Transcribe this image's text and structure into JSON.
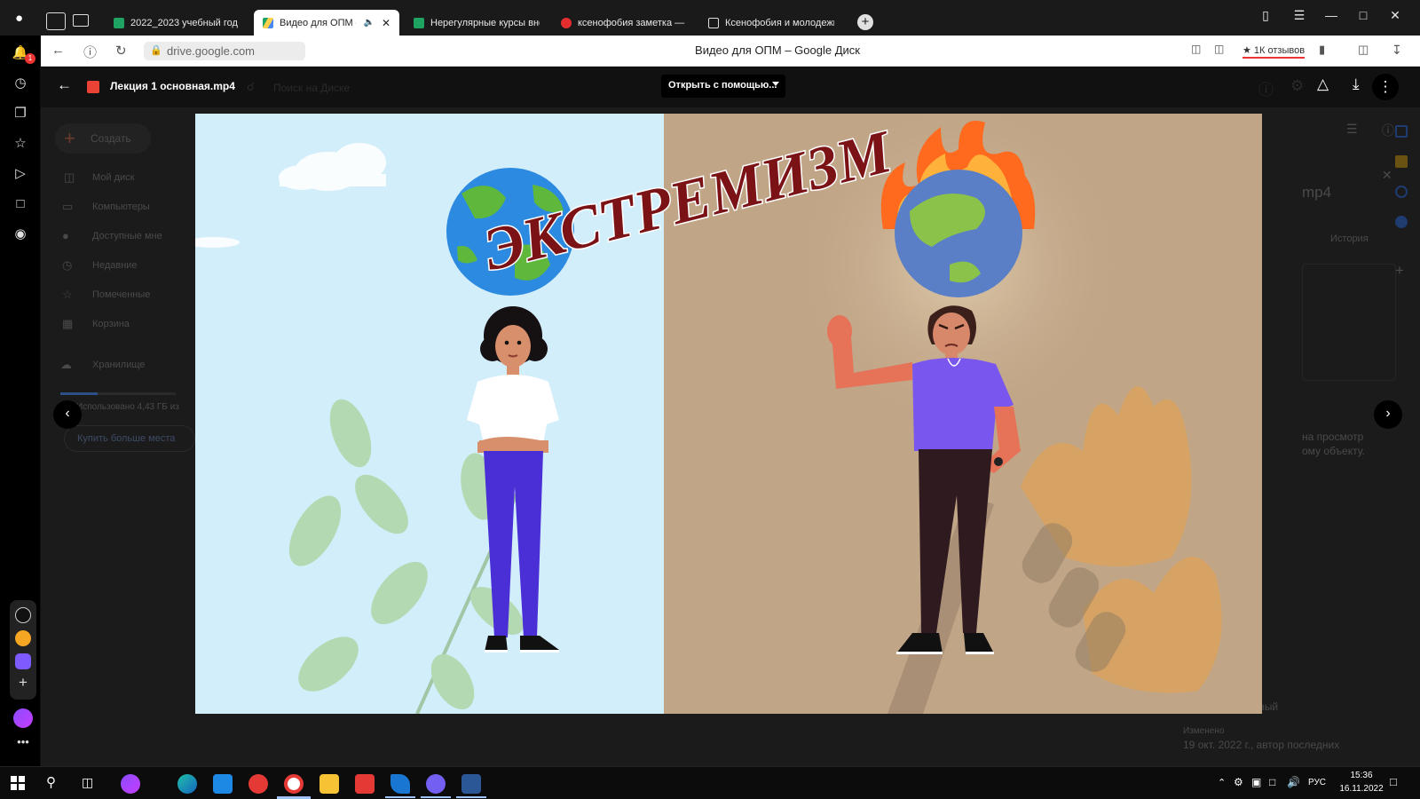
{
  "browser": {
    "tabs": [
      {
        "label": "2022_2023 учебный год -",
        "favicon": "sheets-icon",
        "active": false
      },
      {
        "label": "Видео для ОПМ – G",
        "favicon": "drive-icon",
        "active": true
      },
      {
        "label": "Нерегулярные курсы вне",
        "favicon": "sheets-icon",
        "active": false
      },
      {
        "label": "ксенофобия заметка — Я",
        "favicon": "yandex-icon",
        "active": false
      },
      {
        "label": "Ксенофобия и молодежь",
        "favicon": "document-icon",
        "active": false
      }
    ],
    "address": "drive.google.com",
    "page_title": "Видео для ОПМ – Google Диск",
    "reviews_badge": "★ 1К отзывов",
    "notification_count": "1"
  },
  "drive": {
    "create_label": "Создать",
    "nav_items": [
      {
        "label": "Мой диск",
        "icon": "drive-folder-icon"
      },
      {
        "label": "Компьютеры",
        "icon": "computer-icon"
      },
      {
        "label": "Доступные мне",
        "icon": "people-icon"
      },
      {
        "label": "Недавние",
        "icon": "clock-icon"
      },
      {
        "label": "Помеченные",
        "icon": "star-icon"
      },
      {
        "label": "Корзина",
        "icon": "trash-icon"
      }
    ],
    "storage_label": "Хранилище",
    "storage_used": "Использовано 4,43 ГБ из",
    "buy_more": "Купить больше места",
    "search_placeholder": "Поиск на Диске",
    "details_title_suffix": "mp4",
    "details_tab_history": "История",
    "details_access_text_1": "на просмотр",
    "details_access_text_2": "ому объекту.",
    "details_owner": "Александр Правый",
    "details_modified_label": "Изменено",
    "details_modified_value": "19 окт. 2022 г., автор последних"
  },
  "viewer": {
    "file_name": "Лекция 1 основная.mp4",
    "open_with": "Открыть с помощью...",
    "video_title": "ЭКСТРЕМИЗМ"
  },
  "taskbar": {
    "lang": "РУС",
    "time": "15:36",
    "date": "16.11.2022"
  },
  "colors": {
    "sky": "#d3eefb",
    "tan": "#c1a587",
    "title_red": "#7a1216",
    "shirt_purple": "#7957ee",
    "pants_blue": "#4a2ed6"
  }
}
